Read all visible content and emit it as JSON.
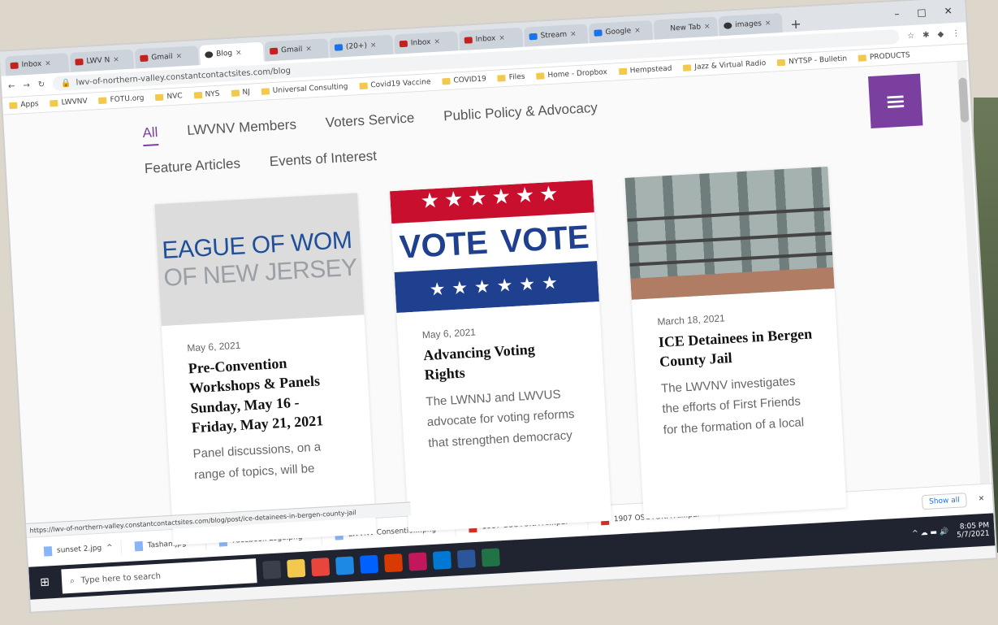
{
  "browser": {
    "tabs": [
      {
        "label": "Inbox",
        "fav": "gmail"
      },
      {
        "label": "LWV N",
        "fav": "gmail"
      },
      {
        "label": "Gmail",
        "fav": "gmail"
      },
      {
        "label": "Blog",
        "fav": "site",
        "active": true
      },
      {
        "label": "Gmail",
        "fav": "gmail"
      },
      {
        "label": "(20+)",
        "fav": "facebook"
      },
      {
        "label": "Inbox",
        "fav": "gmail"
      },
      {
        "label": "Inbox",
        "fav": "gmail"
      },
      {
        "label": "Stream",
        "fav": "blue"
      },
      {
        "label": "Google",
        "fav": "blue"
      },
      {
        "label": "New Tab",
        "fav": "none"
      },
      {
        "label": "images",
        "fav": "google"
      }
    ],
    "new_tab_symbol": "+",
    "window_controls": [
      "–",
      "□",
      "✕"
    ],
    "url": "lwv-of-northern-valley.constantcontactsites.com/blog",
    "bookmarks": [
      "Apps",
      "LWVNV",
      "FOTU.org",
      "NVC",
      "NYS",
      "NJ",
      "Universal Consulting",
      "Covid19 Vaccine",
      "COVID19",
      "Files",
      "Home - Dropbox",
      "Hempstead",
      "Jazz & Virtual Radio",
      "NYTSP - Bulletin",
      "PRODUCTS"
    ]
  },
  "nav": {
    "row1": [
      "All",
      "LWVNV Members",
      "Voters Service",
      "Public Policy & Advocacy"
    ],
    "row2": [
      "Feature Articles",
      "Events of Interest"
    ],
    "menu_icon": "≡"
  },
  "posts": [
    {
      "image_line1": "EAGUE OF WOM",
      "image_line2": "OF NEW JERSEY",
      "date": "May 6, 2021",
      "title": "Pre-Convention Workshops & Panels Sunday, May 16 - Friday, May 21, 2021",
      "excerpt": "Panel discussions, on a range of topics, will be"
    },
    {
      "image_word": "VOTE",
      "date": "May 6, 2021",
      "title": "Advancing Voting Rights",
      "excerpt": "The LWNNJ and LWVUS advocate for voting reforms that strengthen democracy"
    },
    {
      "date": "March 18, 2021",
      "title": "ICE Detainees in Bergen County Jail",
      "excerpt": "The LWVNV investigates the efforts of First Friends for the formation of a local"
    }
  ],
  "status_url": "https://lwv-of-northern-valley.constantcontactsites.com/blog/post/ice-detainees-in-bergen-county-jail",
  "downloads": [
    "sunset 2.jpg",
    "Tashan.jpg",
    "Facebook Logo.png",
    "LWVNV Consentio....png",
    "1907 OSOTONA A....pdf",
    "1907 OSOTONA A....pdf"
  ],
  "show_all": "Show all",
  "taskbar": {
    "search_placeholder": "Type here to search",
    "time": "8:05 PM",
    "date": "5/7/2021"
  },
  "colors": {
    "brand_purple": "#7b3fa0",
    "taskbar": "#1f2430"
  }
}
